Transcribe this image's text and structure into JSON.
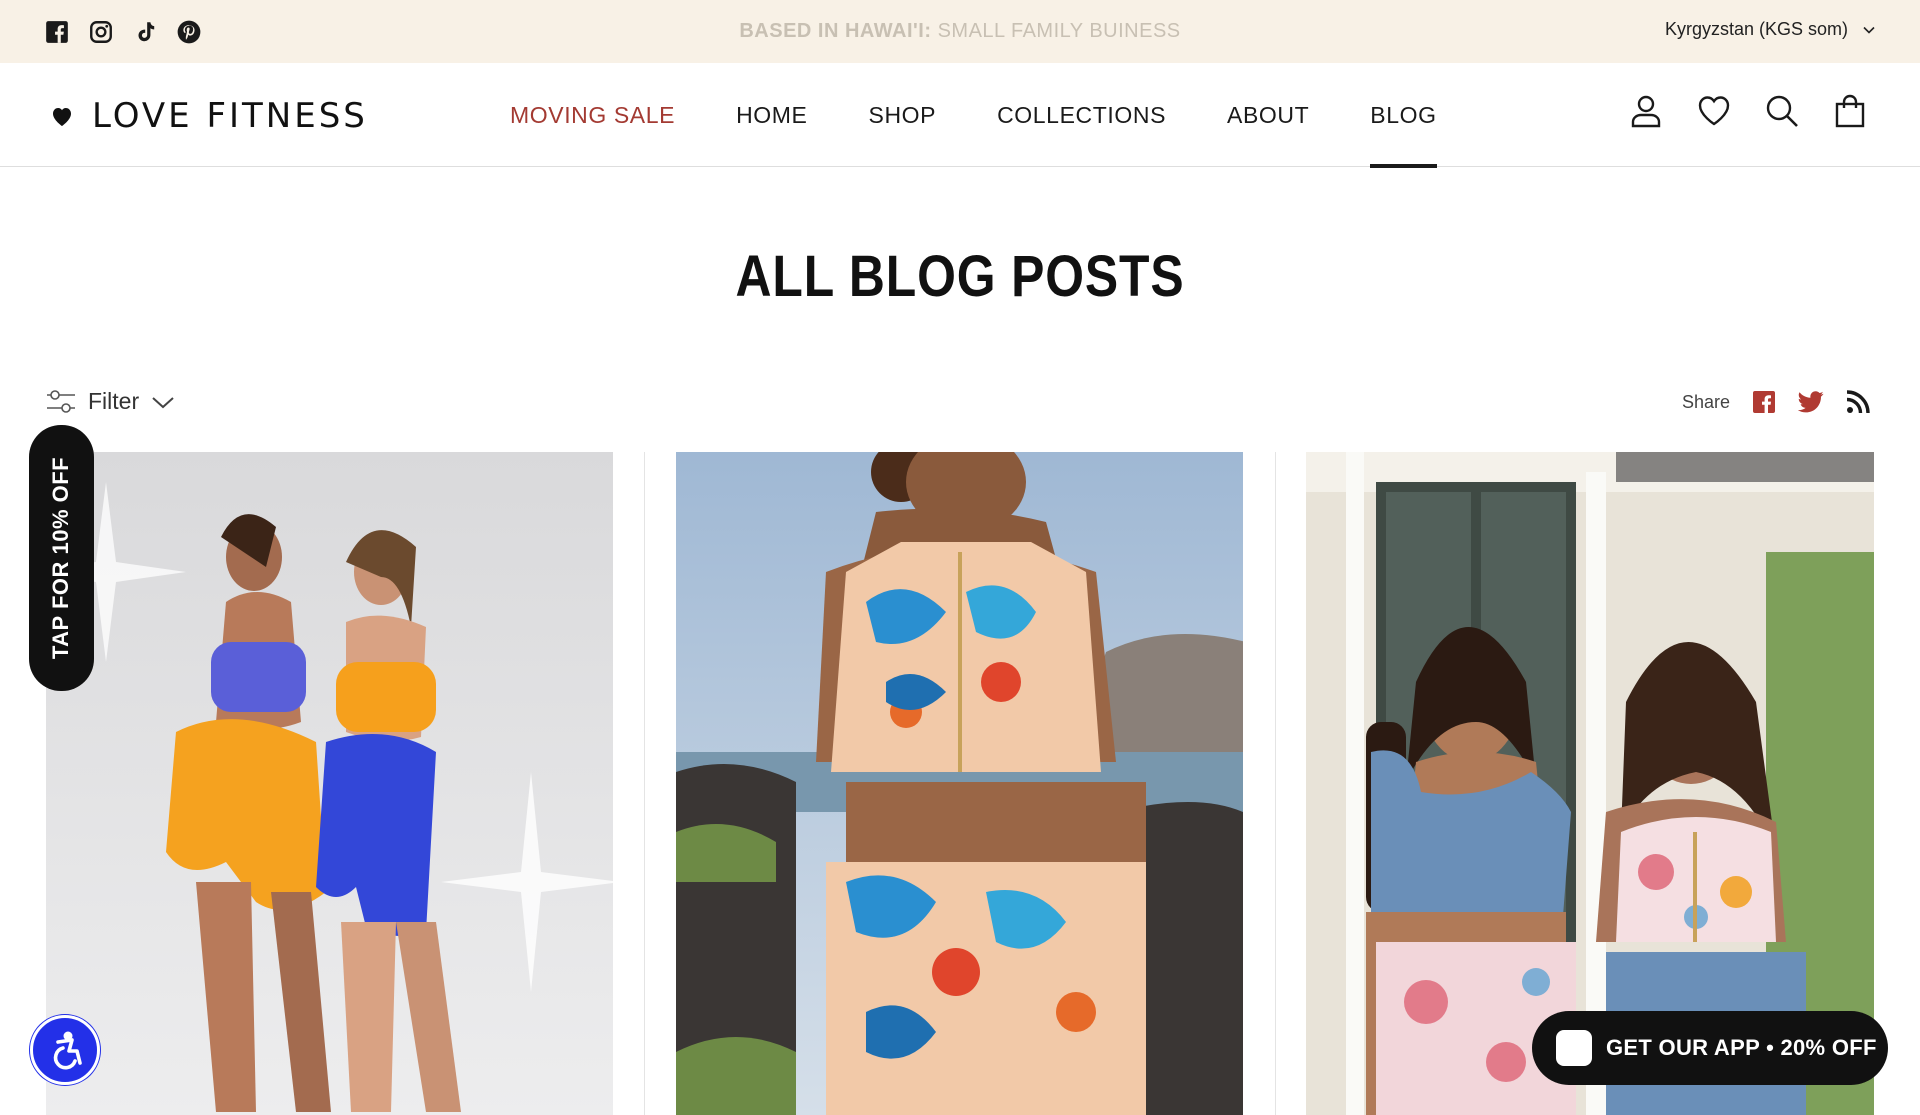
{
  "topbar": {
    "social_icons": [
      "facebook-icon",
      "instagram-icon",
      "tiktok-icon",
      "pinterest-icon"
    ],
    "announcement_bold": "BASED IN HAWAI'I:",
    "announcement_rest": " SMALL FAMILY BUINESS",
    "currency": "Kyrgyzstan (KGS som)"
  },
  "header": {
    "logo_text": "LOVE FITNESS",
    "nav": [
      {
        "label": "MOVING SALE"
      },
      {
        "label": "HOME"
      },
      {
        "label": "SHOP"
      },
      {
        "label": "COLLECTIONS"
      },
      {
        "label": "ABOUT"
      },
      {
        "label": "BLOG"
      }
    ],
    "active_nav": "BLOG",
    "icons": [
      "account-icon",
      "wishlist-heart-icon",
      "search-icon",
      "cart-bag-icon"
    ]
  },
  "page": {
    "title": "ALL BLOG POSTS"
  },
  "toolbar": {
    "filter_label": "Filter",
    "share_label": "Share",
    "share_icons": [
      "facebook-icon",
      "twitter-icon",
      "rss-icon"
    ]
  },
  "widgets": {
    "side_tab": "TAP FOR 10% OFF",
    "app_button": "GET OUR APP • 20% OFF"
  },
  "colors": {
    "announcement_bg": "#f8f1e6",
    "sale_red": "#a33a32",
    "share_red": "#b03a32",
    "accessibility_blue": "#2330e8"
  }
}
